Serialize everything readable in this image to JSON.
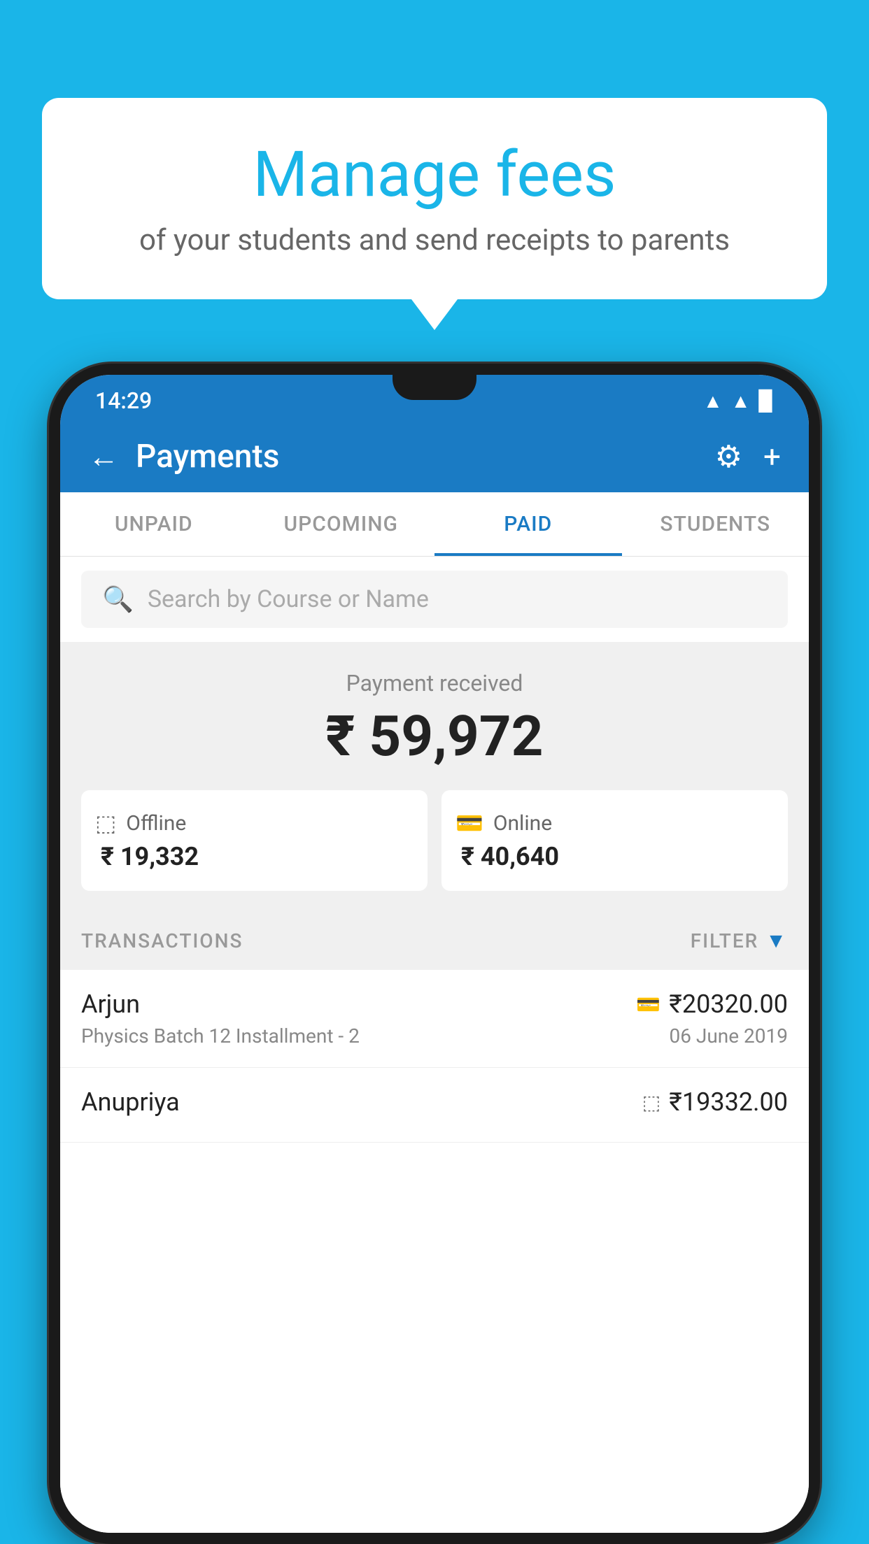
{
  "background_color": "#1ab5e8",
  "speech_bubble": {
    "title": "Manage fees",
    "subtitle": "of your students and send receipts to parents"
  },
  "status_bar": {
    "time": "14:29",
    "wifi": "▲",
    "signal": "▲",
    "battery": "▉"
  },
  "app_bar": {
    "title": "Payments",
    "back_label": "←",
    "gear_label": "⚙",
    "plus_label": "+"
  },
  "tabs": [
    {
      "label": "UNPAID",
      "active": false
    },
    {
      "label": "UPCOMING",
      "active": false
    },
    {
      "label": "PAID",
      "active": true
    },
    {
      "label": "STUDENTS",
      "active": false
    }
  ],
  "search": {
    "placeholder": "Search by Course or Name"
  },
  "payment_summary": {
    "label": "Payment received",
    "amount": "₹ 59,972",
    "offline": {
      "type": "Offline",
      "amount": "₹ 19,332"
    },
    "online": {
      "type": "Online",
      "amount": "₹ 40,640"
    }
  },
  "transactions_section": {
    "label": "TRANSACTIONS",
    "filter_label": "FILTER"
  },
  "transactions": [
    {
      "name": "Arjun",
      "course": "Physics Batch 12 Installment - 2",
      "amount": "₹20320.00",
      "date": "06 June 2019",
      "payment_type": "online"
    },
    {
      "name": "Anupriya",
      "course": "",
      "amount": "₹19332.00",
      "date": "",
      "payment_type": "offline"
    }
  ]
}
